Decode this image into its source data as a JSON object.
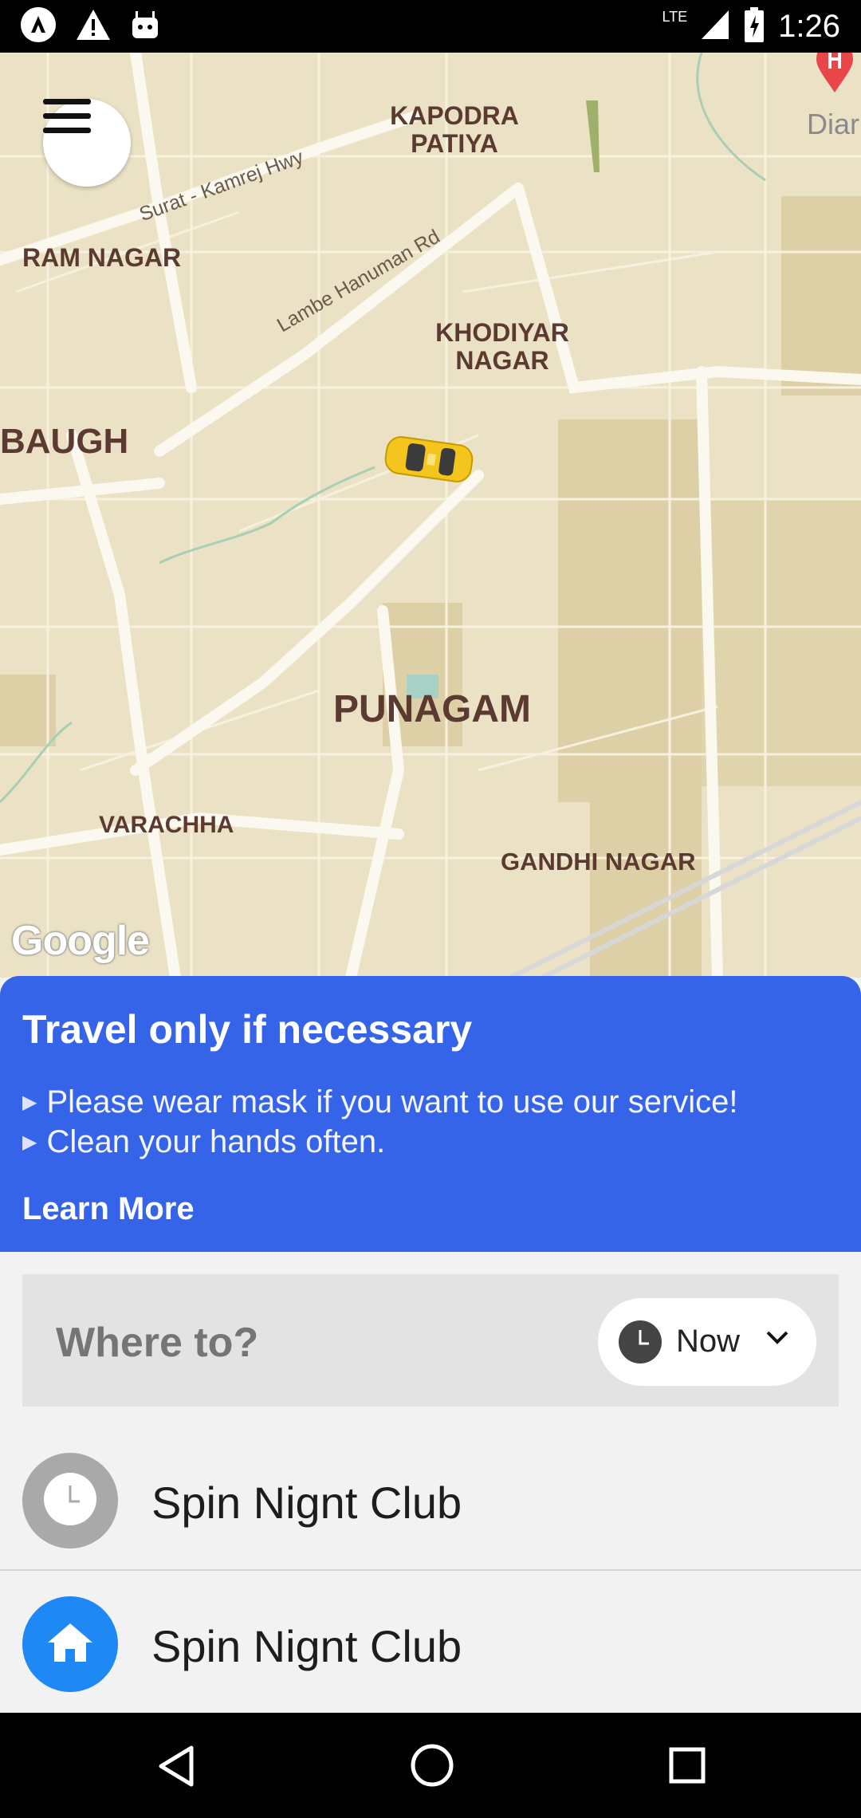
{
  "status_bar": {
    "time": "1:26",
    "network": "LTE",
    "icons": [
      "app-icon",
      "warning-icon",
      "android-icon",
      "signal-icon",
      "battery-icon"
    ]
  },
  "map": {
    "labels": {
      "kapodra_patiya": "KAPODRA\nPATIYA",
      "ram_nagar": "RAM NAGAR",
      "khodiyar_nagar": "KHODIYAR\nNAGAR",
      "baugh": "BAUGH",
      "punagam": "PUNAGAM",
      "varachha": "VARACHHA",
      "gandhi_nagar": "GANDHI NAGAR",
      "diam": "Diar"
    },
    "roads": {
      "surat_kamrej": "Surat - Kamrej Hwy",
      "lambe_hanuman": "Lambe Hanuman Rd"
    },
    "google_logo": "Google",
    "icons": [
      "menu-icon",
      "taxi-icon",
      "hospital-pin-icon"
    ]
  },
  "banner": {
    "title": "Travel only if necessary",
    "items": [
      "Please wear mask if you want to use our service!",
      "Clean your hands often."
    ],
    "learn_more": "Learn More",
    "color": "#3664e8"
  },
  "search": {
    "placeholder": "Where to?",
    "time_option": "Now"
  },
  "recent": [
    {
      "label": "Spin Nignt Club",
      "icon": "clock-icon"
    },
    {
      "label": "Spin Nignt Club",
      "icon": "home-icon"
    }
  ],
  "colors": {
    "accent": "#1e88f5",
    "banner": "#3664e8"
  }
}
